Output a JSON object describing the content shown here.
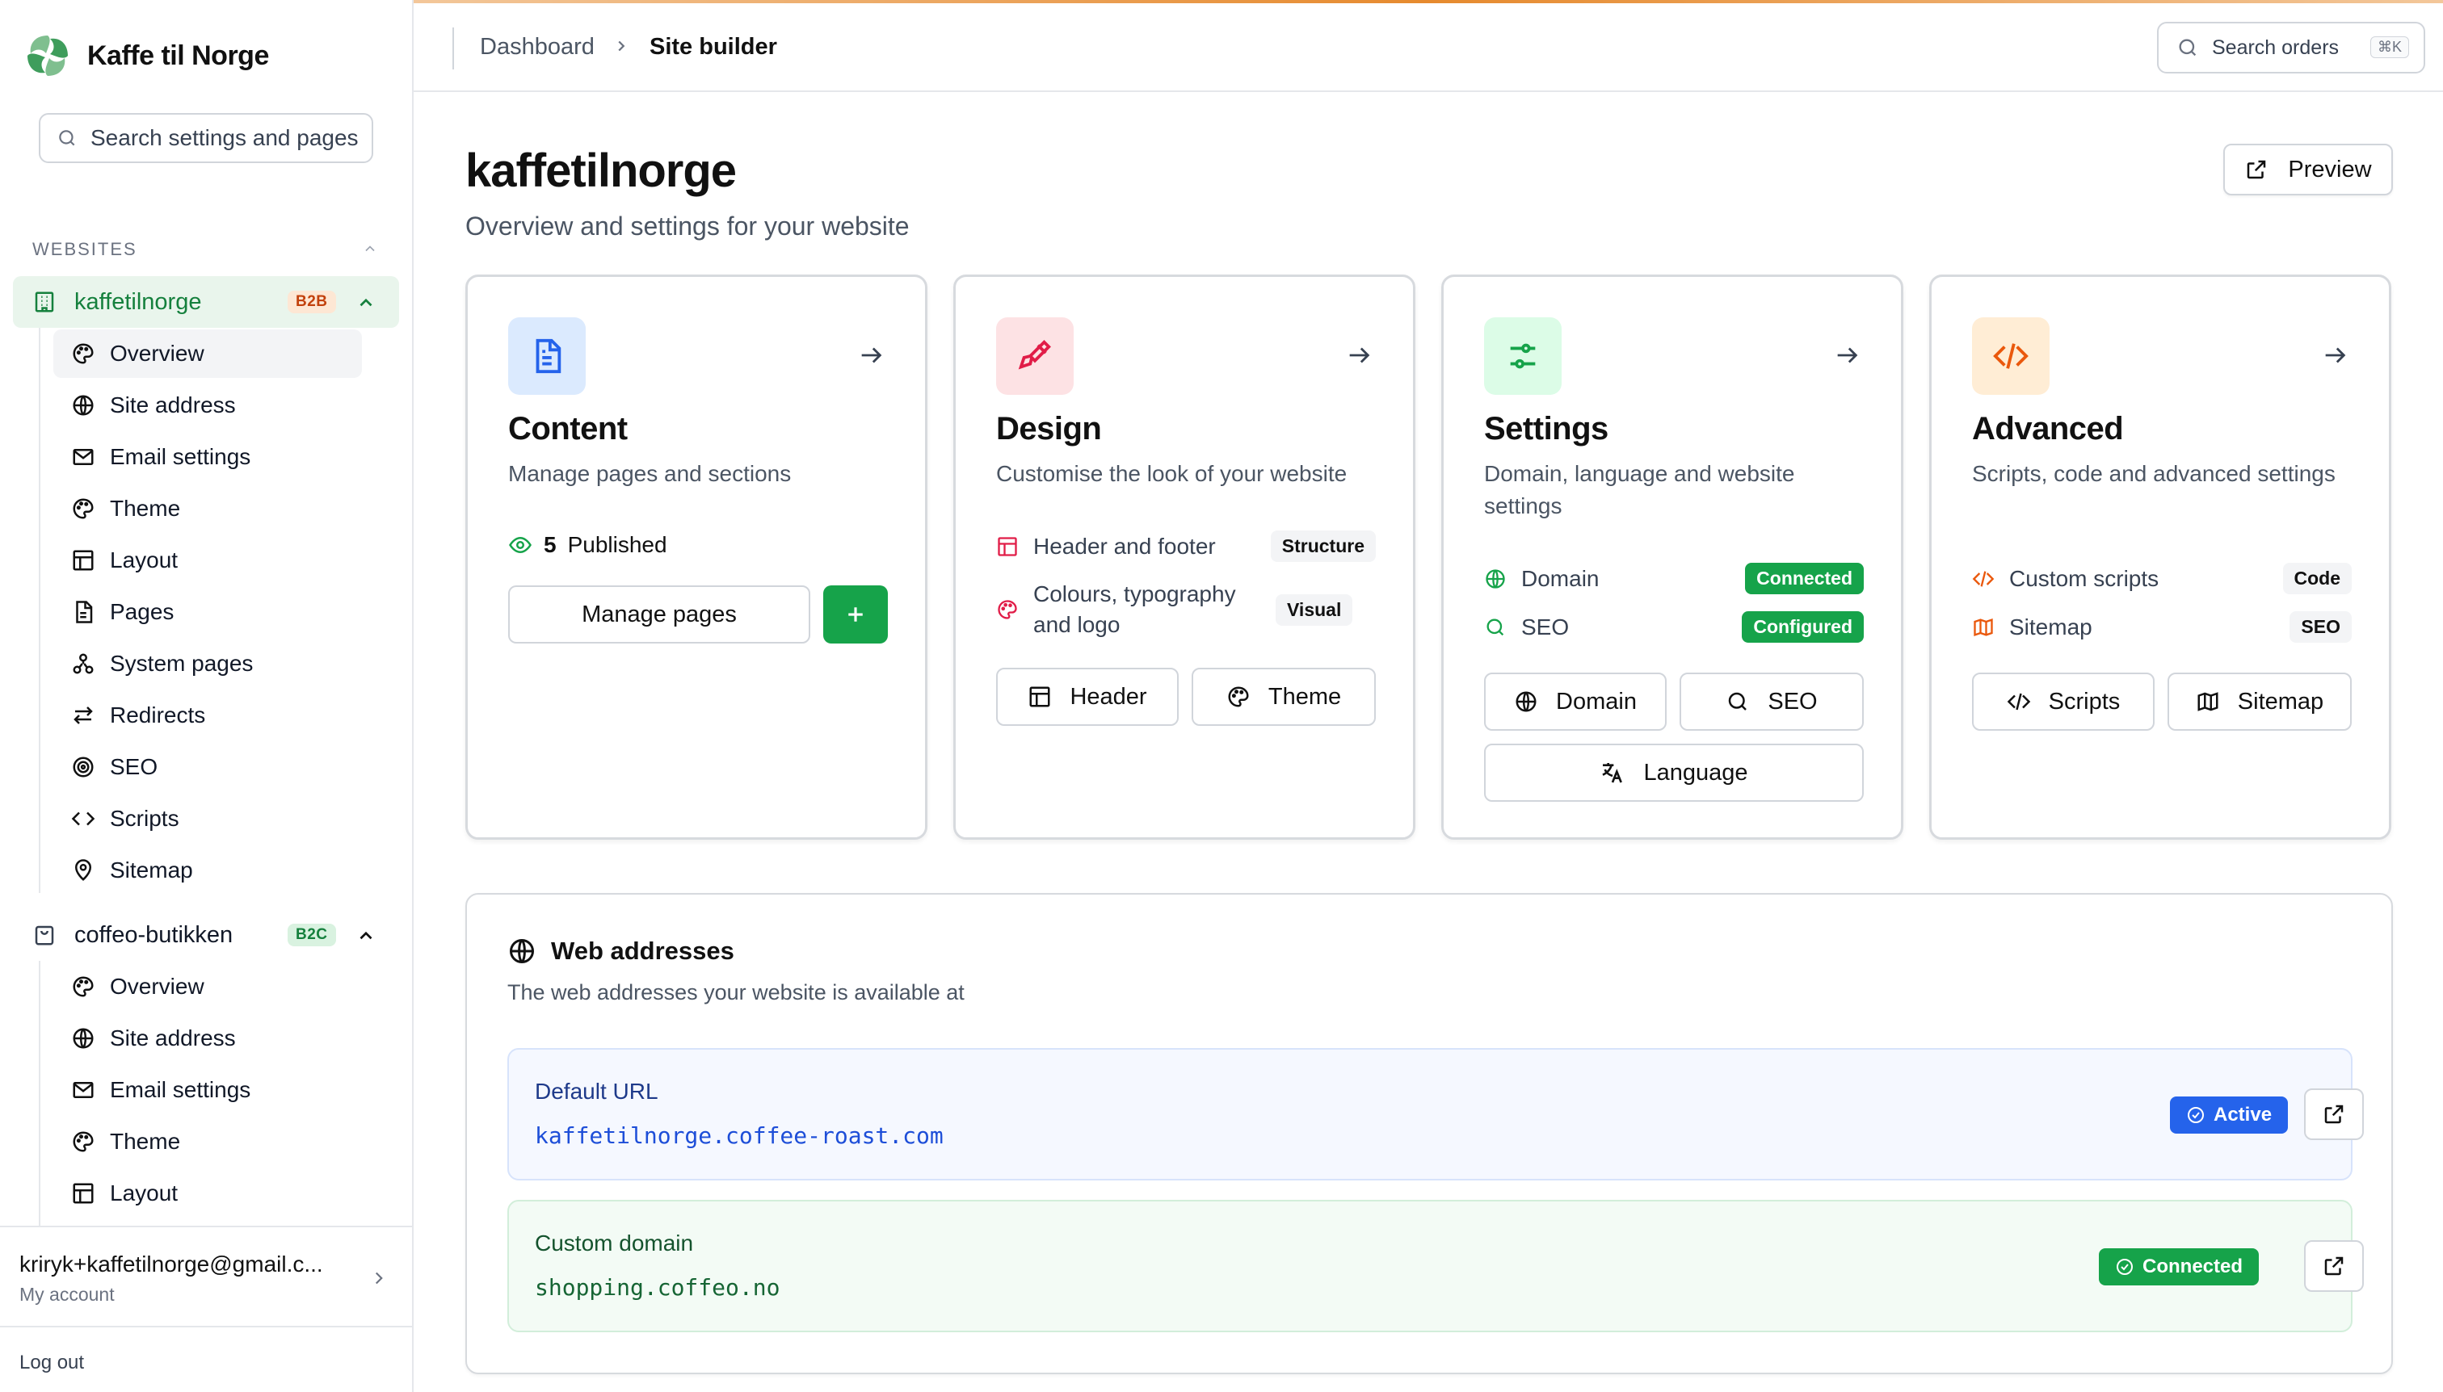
{
  "brand": {
    "name": "Kaffe til Norge"
  },
  "sidebar": {
    "search_placeholder": "Search settings and pages",
    "section_label": "WEBSITES",
    "sites": [
      {
        "name": "kaffetilnorge",
        "badge": "B2B",
        "items": [
          "Overview",
          "Site address",
          "Email settings",
          "Theme",
          "Layout",
          "Pages",
          "System pages",
          "Redirects",
          "SEO",
          "Scripts",
          "Sitemap"
        ]
      },
      {
        "name": "coffeo-butikken",
        "badge": "B2C",
        "items": [
          "Overview",
          "Site address",
          "Email settings",
          "Theme",
          "Layout"
        ]
      }
    ],
    "account_email": "kriryk+kaffetilnorge@gmail.c...",
    "account_label": "My account",
    "logout": "Log out"
  },
  "header": {
    "breadcrumb": [
      "Dashboard",
      "Site builder"
    ],
    "search_placeholder": "Search orders",
    "search_shortcut": "⌘K"
  },
  "page": {
    "title": "kaffetilnorge",
    "subtitle": "Overview and settings for your website",
    "preview_label": "Preview"
  },
  "cards": {
    "content": {
      "title": "Content",
      "desc": "Manage pages and sections",
      "published_count": "5",
      "published_label": "Published",
      "manage_label": "Manage pages"
    },
    "design": {
      "title": "Design",
      "desc": "Customise the look of your website",
      "features": [
        {
          "label": "Header and footer",
          "tag": "Structure"
        },
        {
          "label": "Colours, typography and logo",
          "tag": "Visual"
        }
      ],
      "buttons": [
        "Header",
        "Theme"
      ]
    },
    "settings": {
      "title": "Settings",
      "desc": "Domain, language and website settings",
      "features": [
        {
          "label": "Domain",
          "tag": "Connected"
        },
        {
          "label": "SEO",
          "tag": "Configured"
        }
      ],
      "buttons": [
        "Domain",
        "SEO",
        "Language"
      ]
    },
    "advanced": {
      "title": "Advanced",
      "desc": "Scripts, code and advanced settings",
      "features": [
        {
          "label": "Custom scripts",
          "tag": "Code"
        },
        {
          "label": "Sitemap",
          "tag": "SEO"
        }
      ],
      "buttons": [
        "Scripts",
        "Sitemap"
      ]
    }
  },
  "web_addresses": {
    "title": "Web addresses",
    "subtitle": "The web addresses your website is available at",
    "default": {
      "label": "Default URL",
      "url": "kaffetilnorge.coffee-roast.com",
      "status": "Active"
    },
    "custom": {
      "label": "Custom domain",
      "url": "shopping.coffeo.no",
      "status": "Connected"
    }
  },
  "colors": {
    "brand_green": "#16a34a",
    "accent_blue": "#2563eb",
    "badge_orange": "#c2410c",
    "top_accent": "#e68a2e"
  }
}
